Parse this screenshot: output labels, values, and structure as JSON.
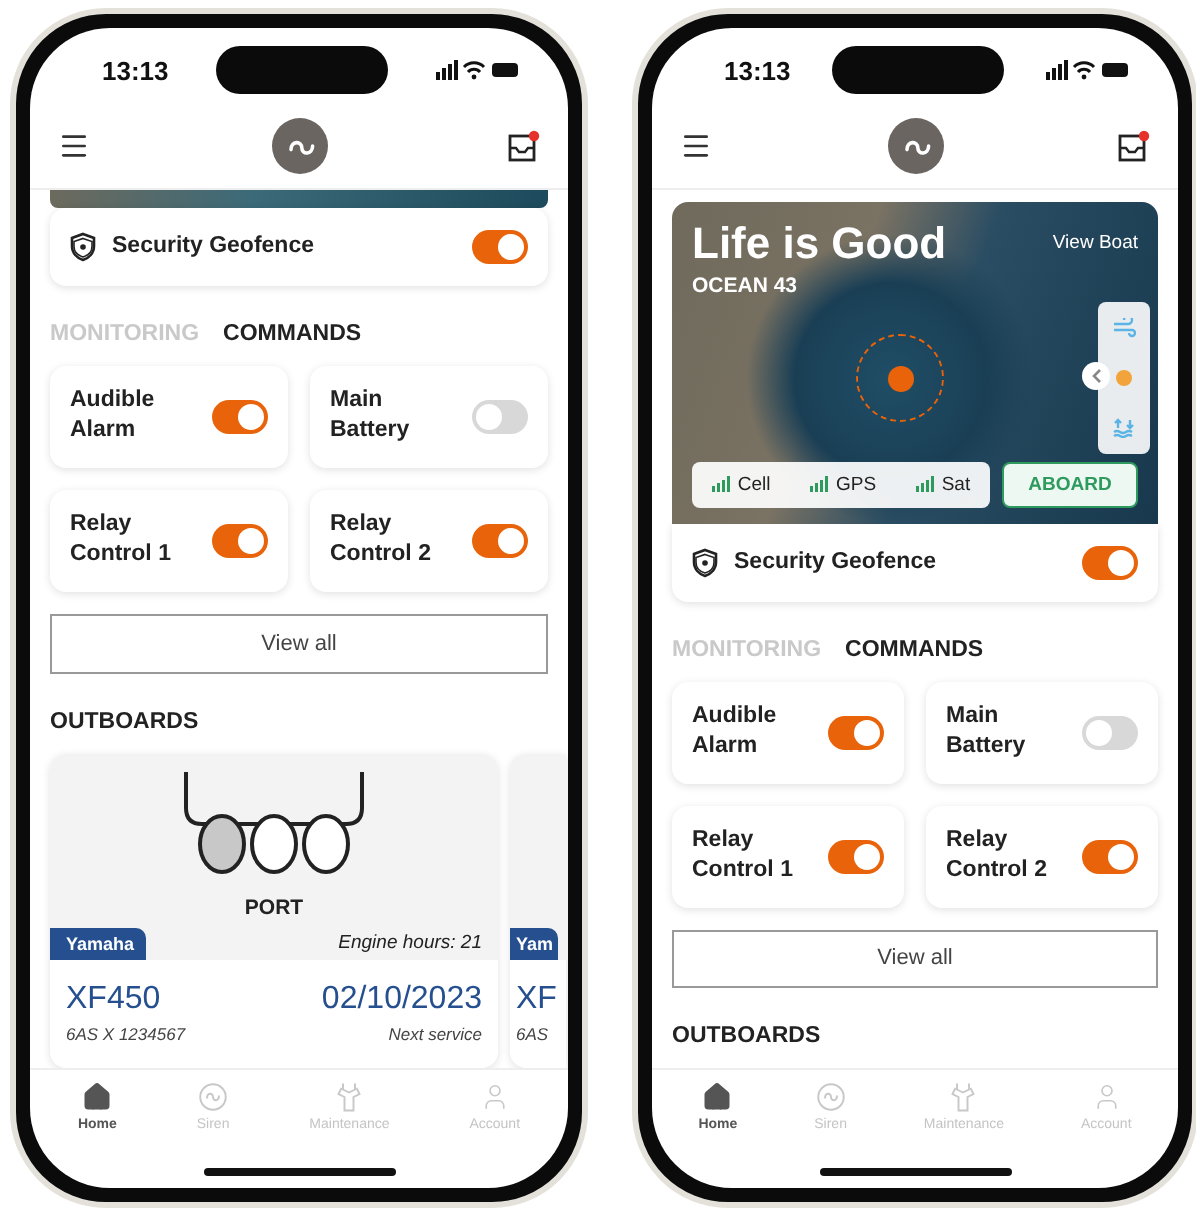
{
  "phones": [
    {
      "time": "13:13",
      "sections": [
        {
          "kind": "map_strip"
        },
        {
          "kind": "geofence",
          "label": "Security Geofence",
          "on": true
        },
        {
          "kind": "tabs",
          "tabs": [
            {
              "label": "MONITORING",
              "selected": false
            },
            {
              "label": "COMMANDS",
              "selected": true
            }
          ]
        },
        {
          "kind": "commands",
          "items": [
            {
              "label": "Audible Alarm",
              "on": true
            },
            {
              "label": "Main Battery",
              "on": false
            },
            {
              "label": "Relay Control 1",
              "on": true
            },
            {
              "label": "Relay Control 2",
              "on": true
            }
          ]
        },
        {
          "kind": "view_all",
          "label": "View all"
        },
        {
          "kind": "outboards",
          "title": "OUTBOARDS",
          "cards": [
            {
              "kind": "full",
              "position": "PORT",
              "engines": [
                {
                  "selected": true
                },
                {
                  "selected": false
                },
                {
                  "selected": false
                }
              ],
              "brand": "Yamaha",
              "hours": "Engine hours: 21",
              "model": "XF450",
              "serial": "6AS X 1234567",
              "date": "02/10/2023",
              "date_label": "Next service"
            },
            {
              "kind": "partial",
              "brand": "Yam",
              "model": "XF",
              "serial": "6AS"
            }
          ]
        }
      ],
      "nav": [
        {
          "label": "Home",
          "selected": true
        },
        {
          "label": "Siren",
          "selected": false
        },
        {
          "label": "Maintenance",
          "selected": false
        },
        {
          "label": "Account",
          "selected": false
        }
      ]
    },
    {
      "time": "13:13",
      "sections": [
        {
          "kind": "hero",
          "title": "Life is Good",
          "subtitle": "OCEAN 43",
          "link": "View Boat",
          "signals": [
            "Cell",
            "GPS",
            "Sat"
          ],
          "status": "ABOARD"
        },
        {
          "kind": "geofence",
          "label": "Security Geofence",
          "on": true
        },
        {
          "kind": "tabs",
          "tabs": [
            {
              "label": "MONITORING",
              "selected": false
            },
            {
              "label": "COMMANDS",
              "selected": true
            }
          ]
        },
        {
          "kind": "commands",
          "items": [
            {
              "label": "Audible Alarm",
              "on": true
            },
            {
              "label": "Main Battery",
              "on": false
            },
            {
              "label": "Relay Control 1",
              "on": true
            },
            {
              "label": "Relay Control 2",
              "on": true
            }
          ]
        },
        {
          "kind": "view_all",
          "label": "View all"
        },
        {
          "kind": "outboards",
          "title": "OUTBOARDS"
        }
      ],
      "nav": [
        {
          "label": "Home",
          "selected": true
        },
        {
          "label": "Siren",
          "selected": false
        },
        {
          "label": "Maintenance",
          "selected": false
        },
        {
          "label": "Account",
          "selected": false
        }
      ]
    }
  ]
}
